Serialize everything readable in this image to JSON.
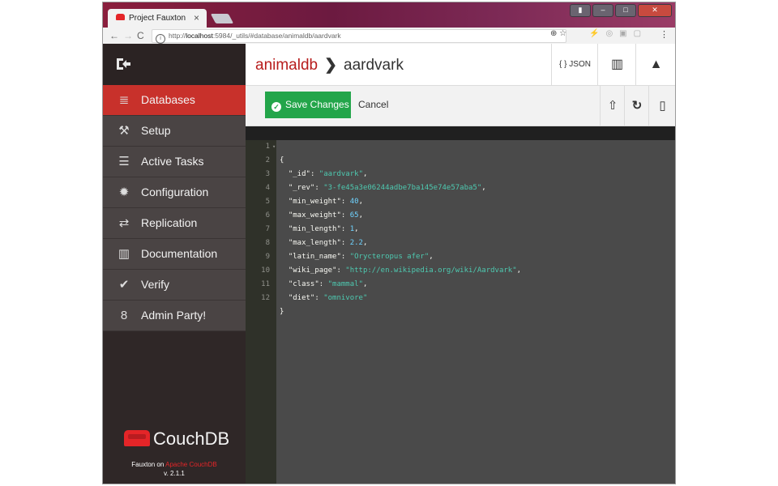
{
  "browser": {
    "tab_title": "Project Fauxton",
    "tab_close": "×",
    "url_prefix": "http://",
    "url_host": "localhost",
    "url_path": ":5984/_utils/#database/animaldb/aardvark"
  },
  "sidebar": {
    "items": [
      {
        "label": "Databases",
        "icon": "database-icon"
      },
      {
        "label": "Setup",
        "icon": "wrench-icon"
      },
      {
        "label": "Active Tasks",
        "icon": "tasks-icon"
      },
      {
        "label": "Configuration",
        "icon": "gear-icon"
      },
      {
        "label": "Replication",
        "icon": "replication-icon"
      },
      {
        "label": "Documentation",
        "icon": "book-icon"
      },
      {
        "label": "Verify",
        "icon": "check-circle-icon"
      },
      {
        "label": "Admin Party!",
        "icon": "user-icon"
      }
    ],
    "logo_text": "CouchDB",
    "footer_prefix": "Fauxton on",
    "footer_link": "Apache CouchDB",
    "footer_version": "v. 2.1.1"
  },
  "header": {
    "database": "animaldb",
    "separator": "❯",
    "document": "aardvark",
    "json_label": "{ } JSON"
  },
  "toolbar": {
    "save_label": "Save Changes",
    "cancel_label": "Cancel"
  },
  "editor": {
    "line_numbers": [
      "1",
      "2",
      "3",
      "4",
      "5",
      "6",
      "7",
      "8",
      "9",
      "10",
      "11",
      "12"
    ]
  },
  "document": {
    "_id": "aardvark",
    "_rev": "3-fe45a3e06244adbe7ba145e74e57aba5",
    "min_weight": 40,
    "max_weight": 65,
    "min_length": 1,
    "max_length": 2.2,
    "latin_name": "Orycteropus afer",
    "wiki_page": "http://en.wikipedia.org/wiki/Aardvark",
    "class": "mammal",
    "diet": "omnivore"
  },
  "colors": {
    "accent": "#c8312b",
    "save_green": "#23a54a",
    "sidebar_bg": "#2f2727"
  }
}
